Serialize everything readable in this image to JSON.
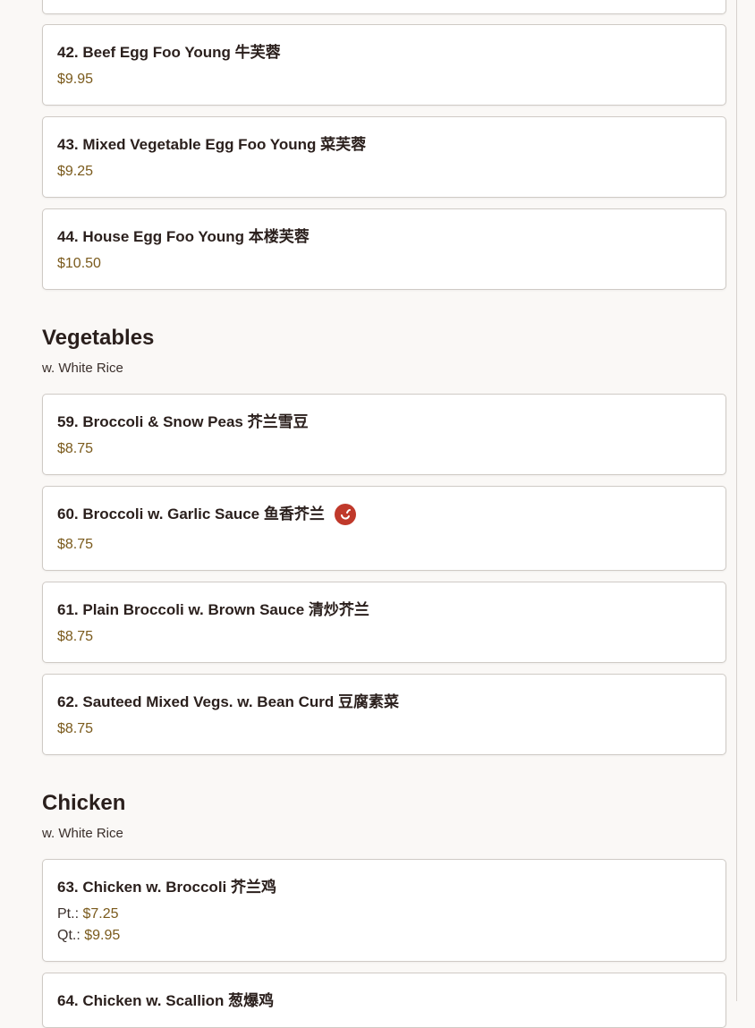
{
  "sections": {
    "egg_foo_young": {
      "items": [
        {
          "name": "42. Beef Egg Foo Young 牛芙蓉",
          "price": "$9.95"
        },
        {
          "name": "43. Mixed Vegetable Egg Foo Young 菜芙蓉",
          "price": "$9.25"
        },
        {
          "name": "44. House Egg Foo Young 本楼芙蓉",
          "price": "$10.50"
        }
      ]
    },
    "vegetables": {
      "title": "Vegetables",
      "subtitle": "w. White Rice",
      "items": [
        {
          "name": "59. Broccoli & Snow Peas 芥兰雪豆",
          "price": "$8.75"
        },
        {
          "name": "60. Broccoli w. Garlic Sauce 鱼香芥兰",
          "price": "$8.75",
          "spicy": true
        },
        {
          "name": "61. Plain Broccoli w. Brown Sauce 清炒芥兰",
          "price": "$8.75"
        },
        {
          "name": "62. Sauteed Mixed Vegs. w. Bean Curd 豆腐素菜",
          "price": "$8.75"
        }
      ]
    },
    "chicken": {
      "title": "Chicken",
      "subtitle": "w. White Rice",
      "items": [
        {
          "name": "63. Chicken w. Broccoli 芥兰鸡",
          "pt_label": "Pt.:",
          "pt_price": "$7.25",
          "qt_label": "Qt.:",
          "qt_price": "$9.95"
        },
        {
          "name": "64. Chicken w. Scallion 葱爆鸡"
        }
      ]
    }
  },
  "icons": {
    "spicy": "chili-pepper-icon"
  },
  "colors": {
    "price": "#7a5a1c",
    "spicy": "#c0392b",
    "card_border": "#cfcac5",
    "background": "#faf8f6"
  }
}
